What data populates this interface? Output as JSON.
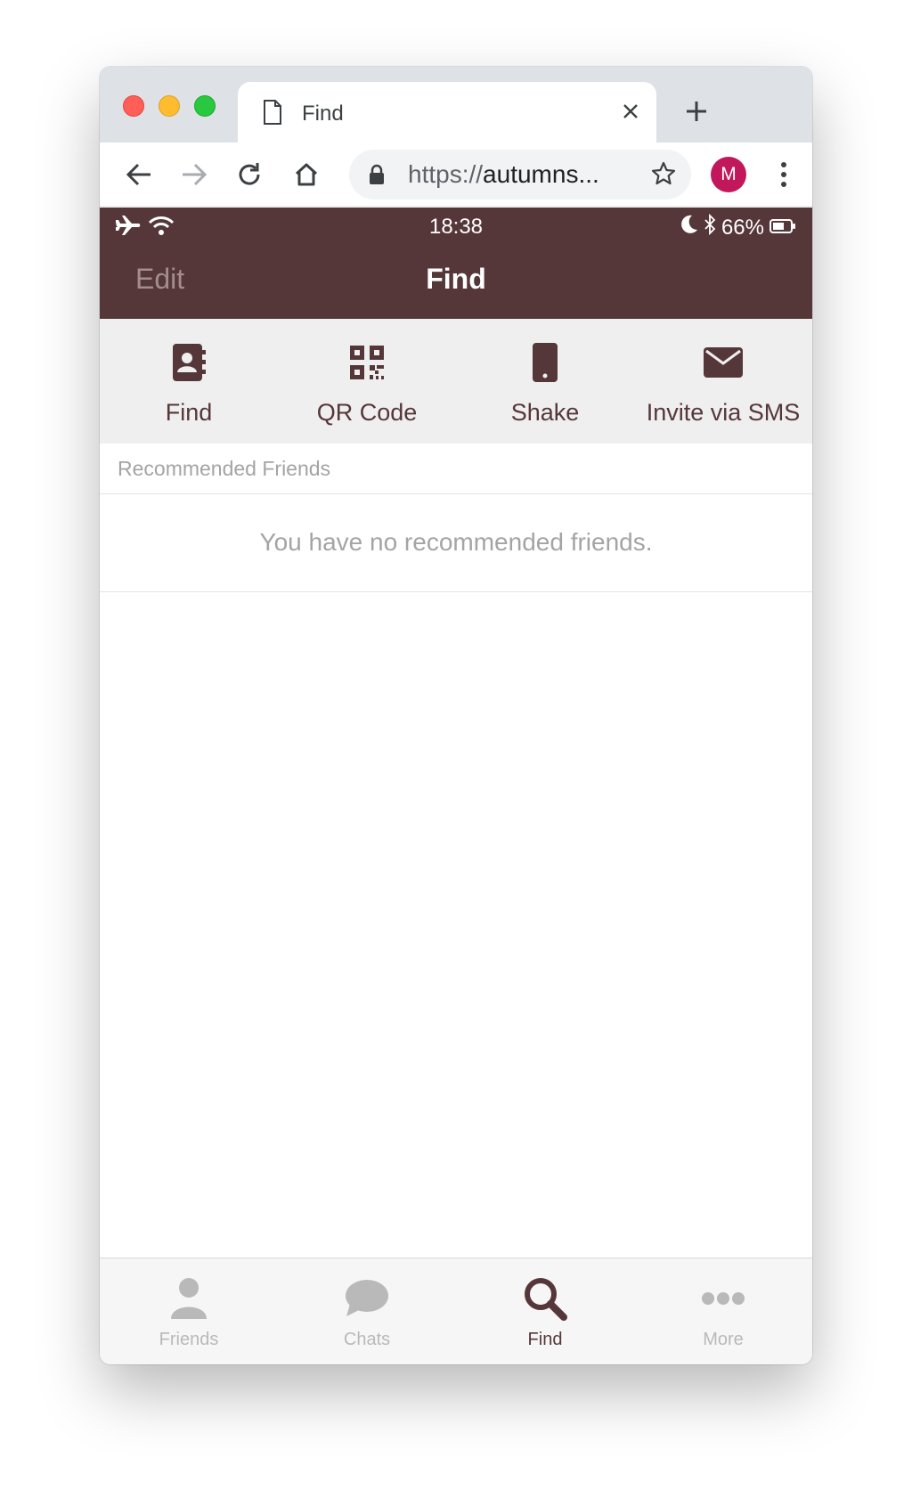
{
  "browser": {
    "tab_title": "Find",
    "url_scheme": "https://",
    "url_rest": "autumns...",
    "profile_initial": "M"
  },
  "status_bar": {
    "time": "18:38",
    "battery": "66%"
  },
  "nav": {
    "left_button": "Edit",
    "title": "Find"
  },
  "quick_actions": [
    {
      "label": "Find",
      "icon": "contacts-book-icon"
    },
    {
      "label": "QR Code",
      "icon": "qr-code-icon"
    },
    {
      "label": "Shake",
      "icon": "phone-icon"
    },
    {
      "label": "Invite via SMS",
      "icon": "envelope-icon"
    }
  ],
  "recommended": {
    "header": "Recommended Friends",
    "empty_message": "You have no recommended friends."
  },
  "tab_bar": {
    "items": [
      {
        "label": "Friends",
        "icon": "person-icon",
        "active": false
      },
      {
        "label": "Chats",
        "icon": "chat-bubble-icon",
        "active": false
      },
      {
        "label": "Find",
        "icon": "search-icon",
        "active": true
      },
      {
        "label": "More",
        "icon": "more-dots-icon",
        "active": false
      }
    ]
  },
  "colors": {
    "brand": "#563739",
    "inactive": "#b9b9b9",
    "muted_text": "#a4a4a4"
  }
}
